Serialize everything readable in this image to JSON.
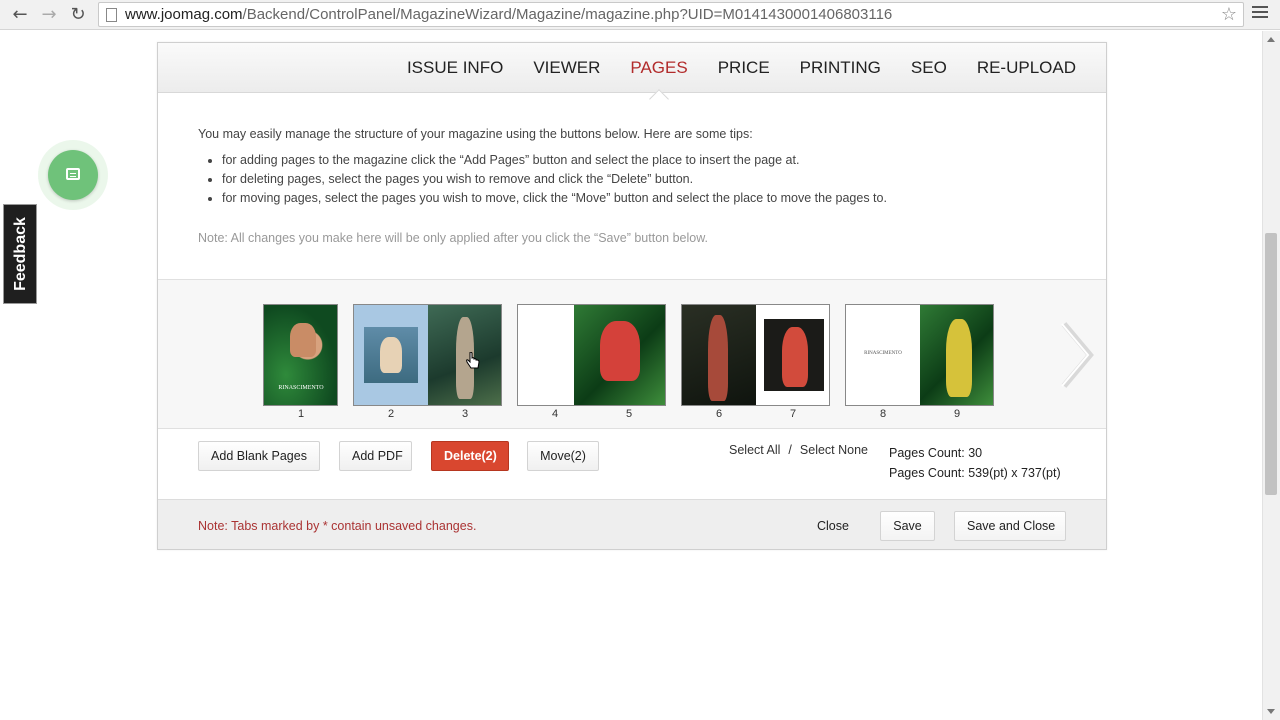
{
  "browser": {
    "url_host": "www.joomag.com",
    "url_path": "/Backend/ControlPanel/MagazineWizard/Magazine/magazine.php?UID=M0141430001406803116"
  },
  "feedback": {
    "label": "Feedback"
  },
  "tabs": [
    {
      "label": "ISSUE INFO",
      "active": false
    },
    {
      "label": "VIEWER",
      "active": false
    },
    {
      "label": "PAGES",
      "active": true
    },
    {
      "label": "PRICE",
      "active": false
    },
    {
      "label": "PRINTING",
      "active": false
    },
    {
      "label": "SEO",
      "active": false
    },
    {
      "label": "RE-UPLOAD",
      "active": false
    }
  ],
  "intro": {
    "lead": "You may easily manage the structure of your magazine using the buttons below. Here are some tips:",
    "tips": [
      "for adding pages to the magazine click the “Add Pages” button and select the place to insert the page at.",
      "for deleting pages, select the pages you wish to remove and click the “Delete” button.",
      "for moving pages, select the pages you wish to move, click the “Move” button and select the place to move the pages to."
    ],
    "note": "Note: All changes you make here will be only applied after you click the “Save” button below."
  },
  "pages": [
    {
      "num": "1",
      "art": "art-green",
      "selected": false
    },
    {
      "num": "2",
      "art": "art-blue",
      "selected": true
    },
    {
      "num": "3",
      "art": "art-jungle",
      "selected": true
    },
    {
      "num": "4",
      "art": "art-white",
      "selected": false
    },
    {
      "num": "5",
      "art": "art-leaves",
      "selected": false
    },
    {
      "num": "6",
      "art": "art-dark",
      "selected": false
    },
    {
      "num": "7",
      "art": "art-white",
      "selected": false
    },
    {
      "num": "8",
      "art": "art-white",
      "selected": false
    },
    {
      "num": "9",
      "art": "art-leaves",
      "selected": false
    }
  ],
  "page8_logo": "RINASCIMENTO",
  "page1_logo": "RINASCIMENTO",
  "actions": {
    "add_blank": "Add Blank Pages",
    "add_pdf": "Add PDF",
    "delete": "Delete(2)",
    "move": "Move(2)",
    "select_all": "Select All",
    "select_sep": "/",
    "select_none": "Select None",
    "pages_count": "Pages Count: 30",
    "pages_size": "Pages Count: 539(pt) x 737(pt)"
  },
  "footer": {
    "note": "Note: Tabs marked by * contain unsaved changes.",
    "close": "Close",
    "save": "Save",
    "save_close": "Save and Close"
  },
  "colors": {
    "accent_active_tab": "#b22c2c",
    "danger_button": "#d9472f",
    "chat_bubble": "#6fc27a"
  }
}
